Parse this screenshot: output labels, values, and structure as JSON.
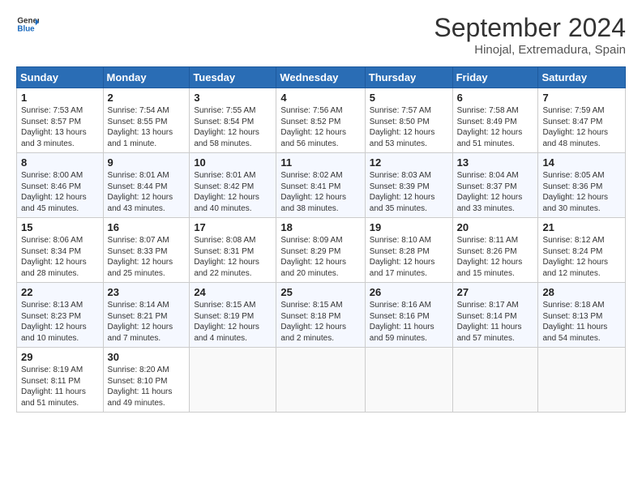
{
  "header": {
    "logo_line1": "General",
    "logo_line2": "Blue",
    "month": "September 2024",
    "location": "Hinojal, Extremadura, Spain"
  },
  "weekdays": [
    "Sunday",
    "Monday",
    "Tuesday",
    "Wednesday",
    "Thursday",
    "Friday",
    "Saturday"
  ],
  "weeks": [
    [
      {
        "day": "1",
        "info": "Sunrise: 7:53 AM\nSunset: 8:57 PM\nDaylight: 13 hours\nand 3 minutes."
      },
      {
        "day": "2",
        "info": "Sunrise: 7:54 AM\nSunset: 8:55 PM\nDaylight: 13 hours\nand 1 minute."
      },
      {
        "day": "3",
        "info": "Sunrise: 7:55 AM\nSunset: 8:54 PM\nDaylight: 12 hours\nand 58 minutes."
      },
      {
        "day": "4",
        "info": "Sunrise: 7:56 AM\nSunset: 8:52 PM\nDaylight: 12 hours\nand 56 minutes."
      },
      {
        "day": "5",
        "info": "Sunrise: 7:57 AM\nSunset: 8:50 PM\nDaylight: 12 hours\nand 53 minutes."
      },
      {
        "day": "6",
        "info": "Sunrise: 7:58 AM\nSunset: 8:49 PM\nDaylight: 12 hours\nand 51 minutes."
      },
      {
        "day": "7",
        "info": "Sunrise: 7:59 AM\nSunset: 8:47 PM\nDaylight: 12 hours\nand 48 minutes."
      }
    ],
    [
      {
        "day": "8",
        "info": "Sunrise: 8:00 AM\nSunset: 8:46 PM\nDaylight: 12 hours\nand 45 minutes."
      },
      {
        "day": "9",
        "info": "Sunrise: 8:01 AM\nSunset: 8:44 PM\nDaylight: 12 hours\nand 43 minutes."
      },
      {
        "day": "10",
        "info": "Sunrise: 8:01 AM\nSunset: 8:42 PM\nDaylight: 12 hours\nand 40 minutes."
      },
      {
        "day": "11",
        "info": "Sunrise: 8:02 AM\nSunset: 8:41 PM\nDaylight: 12 hours\nand 38 minutes."
      },
      {
        "day": "12",
        "info": "Sunrise: 8:03 AM\nSunset: 8:39 PM\nDaylight: 12 hours\nand 35 minutes."
      },
      {
        "day": "13",
        "info": "Sunrise: 8:04 AM\nSunset: 8:37 PM\nDaylight: 12 hours\nand 33 minutes."
      },
      {
        "day": "14",
        "info": "Sunrise: 8:05 AM\nSunset: 8:36 PM\nDaylight: 12 hours\nand 30 minutes."
      }
    ],
    [
      {
        "day": "15",
        "info": "Sunrise: 8:06 AM\nSunset: 8:34 PM\nDaylight: 12 hours\nand 28 minutes."
      },
      {
        "day": "16",
        "info": "Sunrise: 8:07 AM\nSunset: 8:33 PM\nDaylight: 12 hours\nand 25 minutes."
      },
      {
        "day": "17",
        "info": "Sunrise: 8:08 AM\nSunset: 8:31 PM\nDaylight: 12 hours\nand 22 minutes."
      },
      {
        "day": "18",
        "info": "Sunrise: 8:09 AM\nSunset: 8:29 PM\nDaylight: 12 hours\nand 20 minutes."
      },
      {
        "day": "19",
        "info": "Sunrise: 8:10 AM\nSunset: 8:28 PM\nDaylight: 12 hours\nand 17 minutes."
      },
      {
        "day": "20",
        "info": "Sunrise: 8:11 AM\nSunset: 8:26 PM\nDaylight: 12 hours\nand 15 minutes."
      },
      {
        "day": "21",
        "info": "Sunrise: 8:12 AM\nSunset: 8:24 PM\nDaylight: 12 hours\nand 12 minutes."
      }
    ],
    [
      {
        "day": "22",
        "info": "Sunrise: 8:13 AM\nSunset: 8:23 PM\nDaylight: 12 hours\nand 10 minutes."
      },
      {
        "day": "23",
        "info": "Sunrise: 8:14 AM\nSunset: 8:21 PM\nDaylight: 12 hours\nand 7 minutes."
      },
      {
        "day": "24",
        "info": "Sunrise: 8:15 AM\nSunset: 8:19 PM\nDaylight: 12 hours\nand 4 minutes."
      },
      {
        "day": "25",
        "info": "Sunrise: 8:15 AM\nSunset: 8:18 PM\nDaylight: 12 hours\nand 2 minutes."
      },
      {
        "day": "26",
        "info": "Sunrise: 8:16 AM\nSunset: 8:16 PM\nDaylight: 11 hours\nand 59 minutes."
      },
      {
        "day": "27",
        "info": "Sunrise: 8:17 AM\nSunset: 8:14 PM\nDaylight: 11 hours\nand 57 minutes."
      },
      {
        "day": "28",
        "info": "Sunrise: 8:18 AM\nSunset: 8:13 PM\nDaylight: 11 hours\nand 54 minutes."
      }
    ],
    [
      {
        "day": "29",
        "info": "Sunrise: 8:19 AM\nSunset: 8:11 PM\nDaylight: 11 hours\nand 51 minutes."
      },
      {
        "day": "30",
        "info": "Sunrise: 8:20 AM\nSunset: 8:10 PM\nDaylight: 11 hours\nand 49 minutes."
      },
      {
        "day": "",
        "info": ""
      },
      {
        "day": "",
        "info": ""
      },
      {
        "day": "",
        "info": ""
      },
      {
        "day": "",
        "info": ""
      },
      {
        "day": "",
        "info": ""
      }
    ]
  ]
}
